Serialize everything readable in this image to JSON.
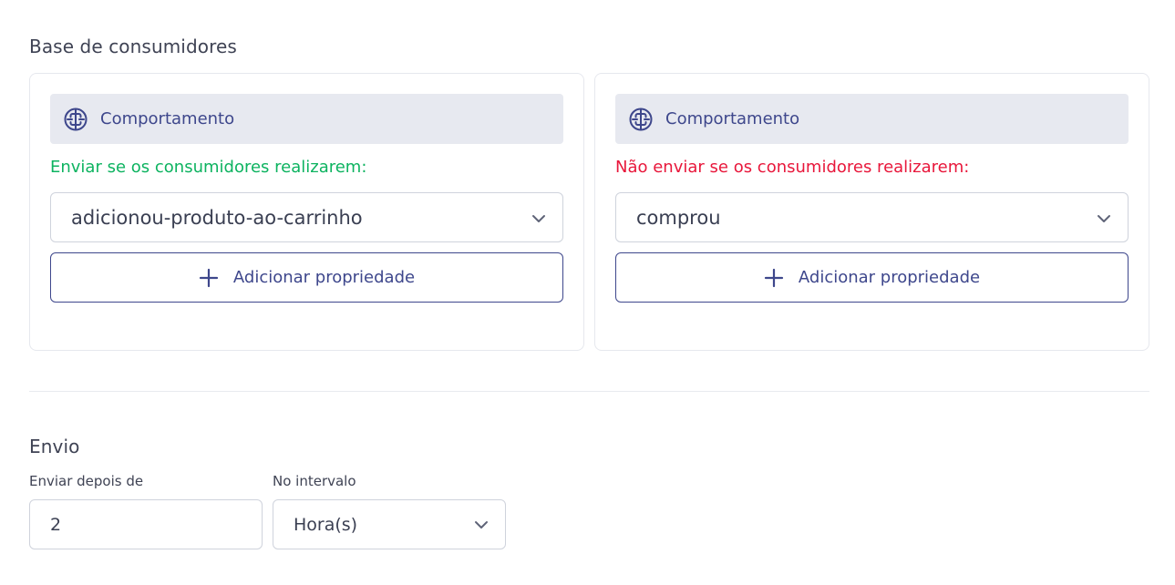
{
  "base": {
    "title": "Base de consumidores",
    "include_card": {
      "header_label": "Comportamento",
      "condition_label": "Enviar se os consumidores realizarem:",
      "selected_event": "adicionou-produto-ao-carrinho",
      "add_property_label": "Adicionar propriedade"
    },
    "exclude_card": {
      "header_label": "Comportamento",
      "condition_label": "Não enviar se os consumidores realizarem:",
      "selected_event": "comprou",
      "add_property_label": "Adicionar propriedade"
    }
  },
  "envio": {
    "title": "Envio",
    "send_after_label": "Enviar depois de",
    "send_after_value": "2",
    "interval_label": "No intervalo",
    "interval_value": "Hora(s)"
  },
  "icons": {
    "header_icon": "brain-icon",
    "select_icon": "chevron-down-icon",
    "add_icon": "plus-icon"
  },
  "colors": {
    "accent": "#3e478c",
    "include": "#0db360",
    "exclude": "#e8173b",
    "header_bg": "#e7e9f0"
  }
}
